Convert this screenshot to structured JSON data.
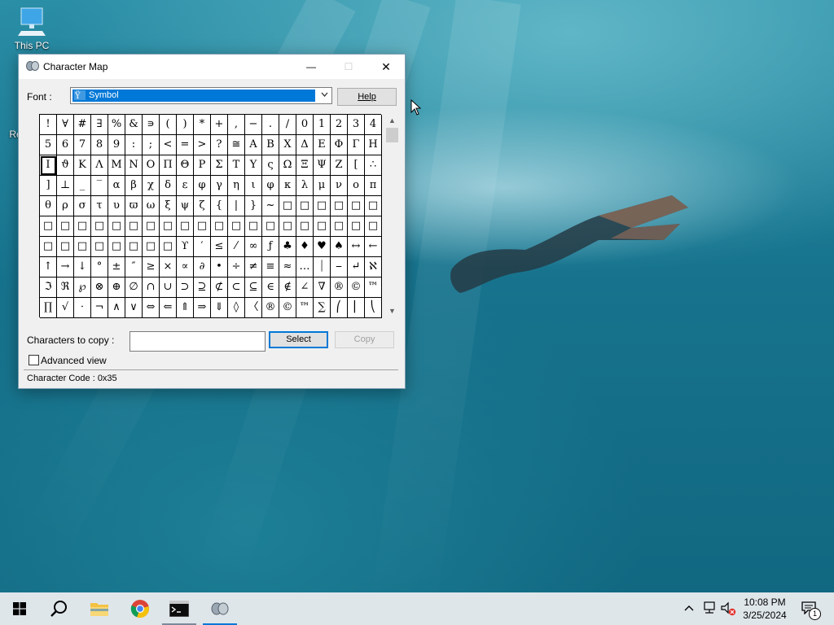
{
  "desktop": {
    "icons": [
      {
        "label": "This PC"
      },
      {
        "label": "Re"
      }
    ]
  },
  "window": {
    "title": "Character Map",
    "controls": {
      "minimize": "—",
      "maximize": "☐",
      "close": "✕"
    },
    "font_label": "Font :",
    "font_value": "Symbol",
    "help_button": "Help",
    "grid_rows": [
      [
        "!",
        "∀",
        "#",
        "∃",
        "%",
        "&",
        "∍",
        "(",
        ")",
        "*",
        "+",
        ",",
        "−",
        ".",
        "/",
        "0",
        "1",
        "2",
        "3",
        "4"
      ],
      [
        "5",
        "6",
        "7",
        "8",
        "9",
        ":",
        ";",
        "<",
        "=",
        ">",
        "?",
        "≅",
        "Α",
        "Β",
        "Χ",
        "Δ",
        "Ε",
        "Φ",
        "Γ",
        "Η"
      ],
      [
        "Ι",
        "ϑ",
        "Κ",
        "Λ",
        "Μ",
        "Ν",
        "Ο",
        "Π",
        "Θ",
        "Ρ",
        "Σ",
        "Τ",
        "Υ",
        "ς",
        "Ω",
        "Ξ",
        "Ψ",
        "Ζ",
        "[",
        "∴"
      ],
      [
        "]",
        "⊥",
        "_",
        "‾",
        "α",
        "β",
        "χ",
        "δ",
        "ε",
        "φ",
        "γ",
        "η",
        "ι",
        "φ",
        "κ",
        "λ",
        "μ",
        "ν",
        "ο",
        "π"
      ],
      [
        "θ",
        "ρ",
        "σ",
        "τ",
        "υ",
        "ϖ",
        "ω",
        "ξ",
        "ψ",
        "ζ",
        "{",
        "|",
        "}",
        "~",
        "□",
        "□",
        "□",
        "□",
        "□",
        "□"
      ],
      [
        "□",
        "□",
        "□",
        "□",
        "□",
        "□",
        "□",
        "□",
        "□",
        "□",
        "□",
        "□",
        "□",
        "□",
        "□",
        "□",
        "□",
        "□",
        "□",
        "□"
      ],
      [
        "□",
        "□",
        "□",
        "□",
        "□",
        "□",
        "□",
        "□",
        "ϒ",
        "′",
        "≤",
        "⁄",
        "∞",
        "ƒ",
        "♣",
        "♦",
        "♥",
        "♠",
        "↔",
        "←"
      ],
      [
        "↑",
        "→",
        "↓",
        "°",
        "±",
        "″",
        "≥",
        "×",
        "∝",
        "∂",
        "•",
        "÷",
        "≠",
        "≡",
        "≈",
        "…",
        "⏐",
        "⎯",
        "↵",
        "ℵ"
      ],
      [
        "ℑ",
        "ℜ",
        "℘",
        "⊗",
        "⊕",
        "∅",
        "∩",
        "∪",
        "⊃",
        "⊇",
        "⊄",
        "⊂",
        "⊆",
        "∈",
        "∉",
        "∠",
        "∇",
        "®",
        "©",
        "™"
      ],
      [
        "∏",
        "√",
        "⋅",
        "¬",
        "∧",
        "∨",
        "⇔",
        "⇐",
        "⇑",
        "⇒",
        "⇓",
        "◊",
        "〈",
        "®",
        "©",
        "™",
        "∑",
        "⎛",
        "⎜",
        "⎝"
      ]
    ],
    "selected_char": "Ι",
    "chars_to_copy_label": "Characters to copy :",
    "chars_to_copy_value": "",
    "select_button": "Select",
    "copy_button": "Copy",
    "advanced_view_label": "Advanced view",
    "advanced_view_checked": false,
    "status": "Character Code : 0x35"
  },
  "taskbar": {
    "items": [
      {
        "name": "start",
        "icon": "windows-logo-icon"
      },
      {
        "name": "search",
        "icon": "search-icon"
      },
      {
        "name": "file-explorer",
        "icon": "folder-icon"
      },
      {
        "name": "chrome",
        "icon": "chrome-icon"
      },
      {
        "name": "terminal",
        "icon": "terminal-icon",
        "state": "open"
      },
      {
        "name": "character-map",
        "icon": "charmap-icon",
        "state": "active"
      }
    ],
    "tray": {
      "time": "10:08 PM",
      "date": "3/25/2024",
      "notification_count": "1"
    }
  }
}
